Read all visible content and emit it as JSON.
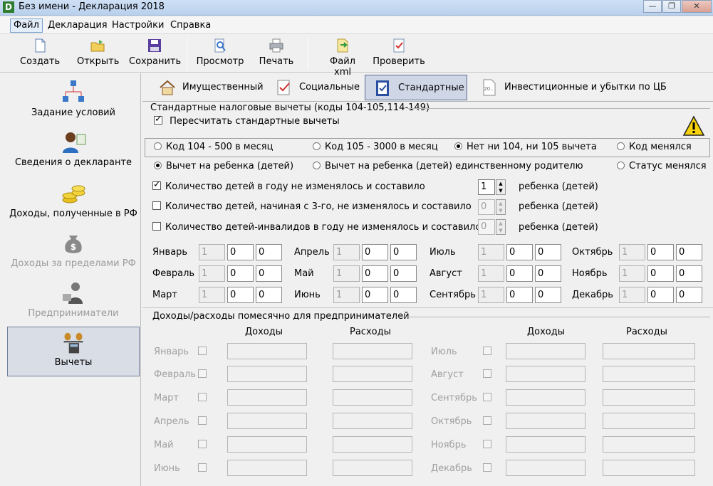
{
  "window": {
    "title": "Без имени - Декларация 2018",
    "app_icon": "D"
  },
  "menu": [
    "Файл",
    "Декларация",
    "Настройки",
    "Справка"
  ],
  "toolbar": {
    "create": "Создать",
    "open": "Открыть",
    "save": "Сохранить",
    "preview": "Просмотр",
    "print": "Печать",
    "xml": "Файл xml",
    "check": "Проверить"
  },
  "sidebar": {
    "conditions": "Задание условий",
    "declarant": "Сведения о декларанте",
    "income_rf": "Доходы, полученные в РФ",
    "income_abroad": "Доходы за пределами РФ",
    "entrepreneurs": "Предприниматели",
    "deductions": "Вычеты"
  },
  "tabs": {
    "property": "Имущественный",
    "social": "Социальные",
    "standard": "Стандартные",
    "investment": "Инвестиционные и убытки по ЦБ"
  },
  "standard": {
    "group_title": "Стандартные налоговые вычеты (коды 104-105,114-149)",
    "recalc": "Пересчитать стандартные вычеты",
    "radio_code104": "Код 104 - 500 в месяц",
    "radio_code105": "Код 105 - 3000 в месяц",
    "radio_none": "Нет ни 104, ни 105 вычета",
    "radio_code_changed": "Код менялся",
    "radio_child": "Вычет на ребенка (детей)",
    "radio_single_parent": "Вычет на ребенка (детей) единственному родителю",
    "radio_status_changed": "Статус менялся",
    "children_same": "Количество детей в году не изменялось и составило",
    "children_third": "Количество детей, начиная с 3-го, не изменялось и составило",
    "children_disabled": "Количество детей-инвалидов в году не изменялось и составило",
    "child_unit": "ребенка (детей)",
    "count1": "1",
    "count2": "0",
    "count3": "0"
  },
  "months": {
    "jan": "Январь",
    "feb": "Февраль",
    "mar": "Март",
    "apr": "Апрель",
    "may": "Май",
    "jun": "Июнь",
    "jul": "Июль",
    "aug": "Август",
    "sep": "Сентябрь",
    "oct": "Октябрь",
    "nov": "Ноябрь",
    "dec": "Декабрь",
    "v1": "1",
    "v0": "0"
  },
  "entrepreneur": {
    "group_title": "Доходы/расходы помесячно для предпринимателей",
    "income": "Доходы",
    "expenses": "Расходы"
  }
}
